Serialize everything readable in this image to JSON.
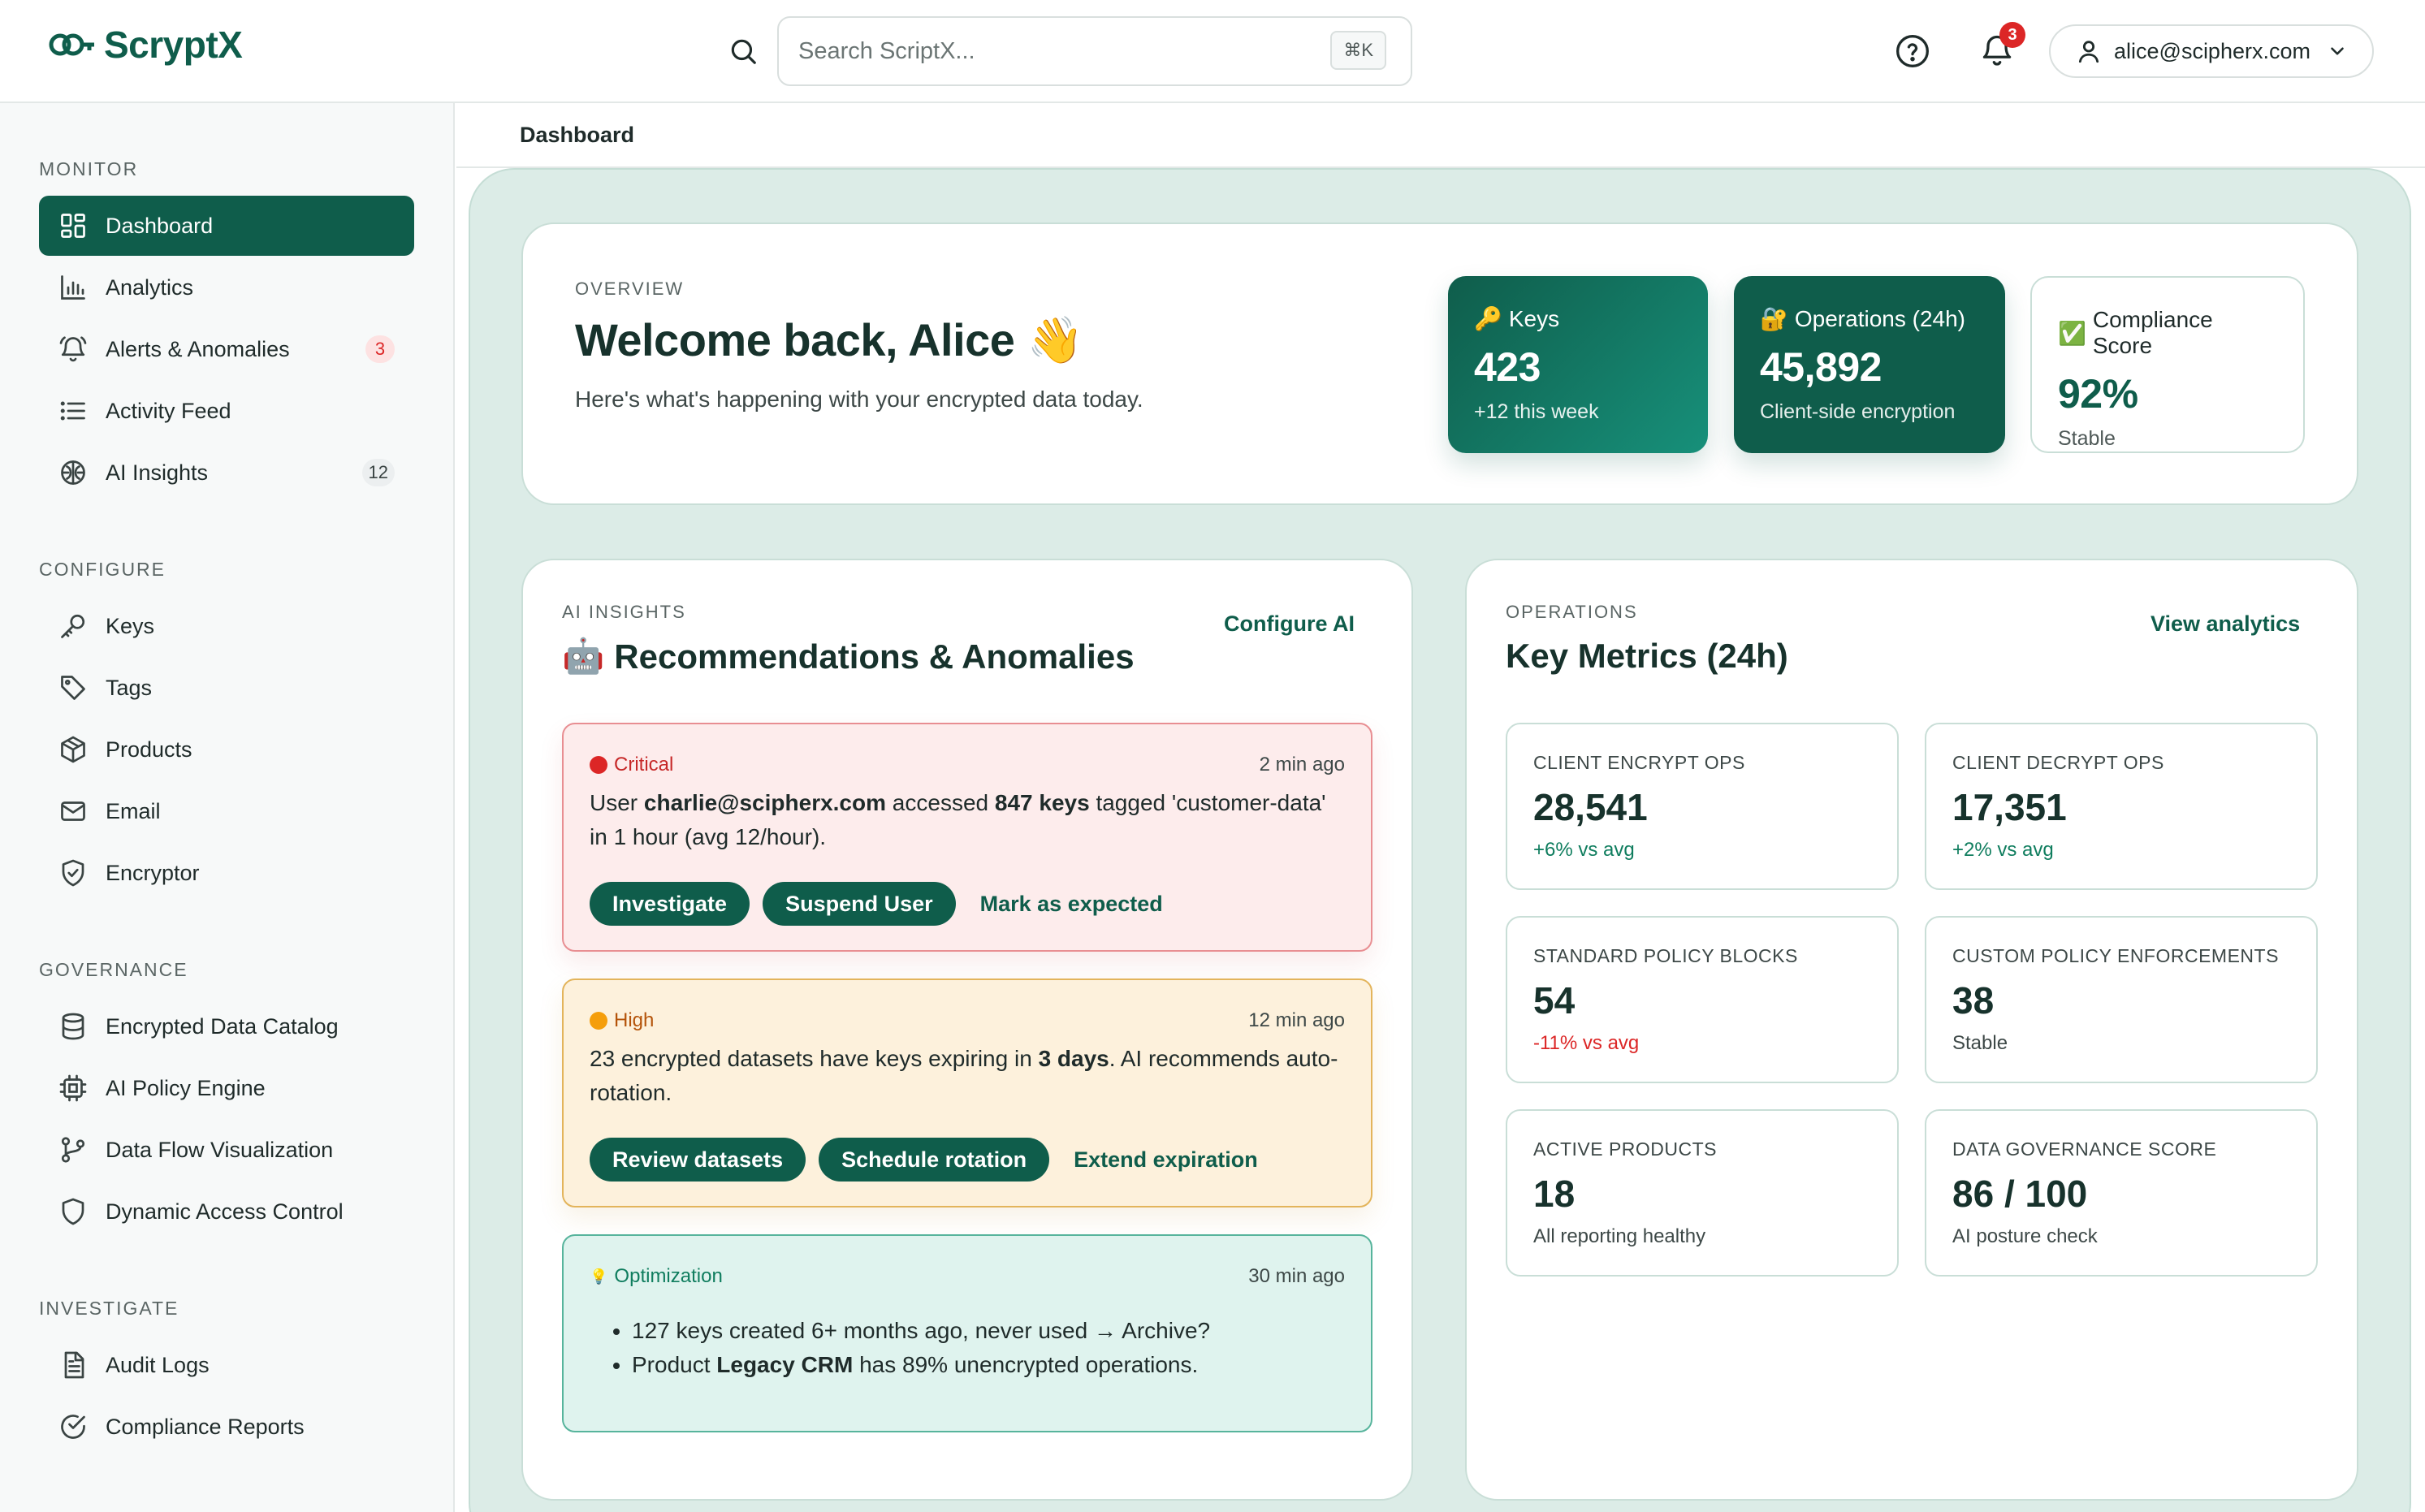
{
  "app": {
    "name": "ScryptX"
  },
  "search": {
    "placeholder": "Search ScriptX...",
    "shortcut": "⌘K"
  },
  "header": {
    "notification_count": "3",
    "user_email": "alice@scipherx.com"
  },
  "sidebar": {
    "sections": {
      "monitor": "MONITOR",
      "configure": "CONFIGURE",
      "governance": "GOVERNANCE",
      "investigate": "INVESTIGATE"
    },
    "items": {
      "dashboard": "Dashboard",
      "analytics": "Analytics",
      "alerts": "Alerts & Anomalies",
      "alerts_badge": "3",
      "activity": "Activity Feed",
      "ai_insights": "AI Insights",
      "ai_insights_badge": "12",
      "keys": "Keys",
      "tags": "Tags",
      "products": "Products",
      "email": "Email",
      "encryptor": "Encryptor",
      "catalog": "Encrypted Data Catalog",
      "policy_engine": "AI Policy Engine",
      "data_flow": "Data Flow Visualization",
      "access_control": "Dynamic Access Control",
      "audit_logs": "Audit Logs",
      "compliance_reports": "Compliance Reports"
    }
  },
  "breadcrumb": {
    "current": "Dashboard"
  },
  "overview": {
    "eyebrow": "OVERVIEW",
    "title": "Welcome back, Alice 👋",
    "subtitle": "Here's what's happening with your encrypted data today.",
    "stats": {
      "keys": {
        "label": "Keys",
        "value": "423",
        "sub": "+12 this week"
      },
      "operations": {
        "label": "Operations (24h)",
        "value": "45,892",
        "sub": "Client-side encryption"
      },
      "compliance": {
        "label": "Compliance Score",
        "value": "92%",
        "sub": "Stable"
      }
    }
  },
  "insights": {
    "eyebrow": "AI INSIGHTS",
    "title": "Recommendations & Anomalies",
    "configure_label": "Configure AI",
    "critical": {
      "severity": "Critical",
      "time": "2 min ago",
      "t1": "User ",
      "user": "charlie@scipherx.com",
      "t2": " accessed ",
      "count": "847 keys",
      "t3": " tagged 'customer-data' in 1 hour (avg 12/hour).",
      "actions": {
        "investigate": "Investigate",
        "suspend": "Suspend User",
        "mark": "Mark as expected"
      }
    },
    "high": {
      "severity": "High",
      "time": "12 min ago",
      "t1": "23 encrypted datasets have keys expiring in ",
      "days": "3 days",
      "t2": ". AI recommends auto-rotation.",
      "actions": {
        "review": "Review datasets",
        "schedule": "Schedule rotation",
        "extend": "Extend expiration"
      }
    },
    "optimization": {
      "severity": "Optimization",
      "time": "30 min ago",
      "item1": "127 keys created 6+ months ago, never used → Archive?",
      "item2_a": "Product ",
      "item2_product": "Legacy CRM",
      "item2_b": " has 89% unencrypted operations."
    }
  },
  "operations": {
    "eyebrow": "OPERATIONS",
    "title": "Key Metrics (24h)",
    "view_label": "View analytics",
    "metrics": [
      {
        "label": "CLIENT ENCRYPT OPS",
        "value": "28,541",
        "sub": "+6% vs avg"
      },
      {
        "label": "CLIENT DECRYPT OPS",
        "value": "17,351",
        "sub": "+2% vs avg"
      },
      {
        "label": "STANDARD POLICY BLOCKS",
        "value": "54",
        "sub": "-11% vs avg"
      },
      {
        "label": "CUSTOM POLICY ENFORCEMENTS",
        "value": "38",
        "sub": "Stable"
      },
      {
        "label": "ACTIVE PRODUCTS",
        "value": "18",
        "sub": "All reporting healthy"
      },
      {
        "label": "DATA GOVERNANCE SCORE",
        "value": "86 / 100",
        "sub": "AI posture check"
      }
    ]
  },
  "colors": {
    "brand": "#0f5d4b",
    "critical": "#dc2626",
    "high": "#f59e0b",
    "panel": "#dcece7"
  }
}
